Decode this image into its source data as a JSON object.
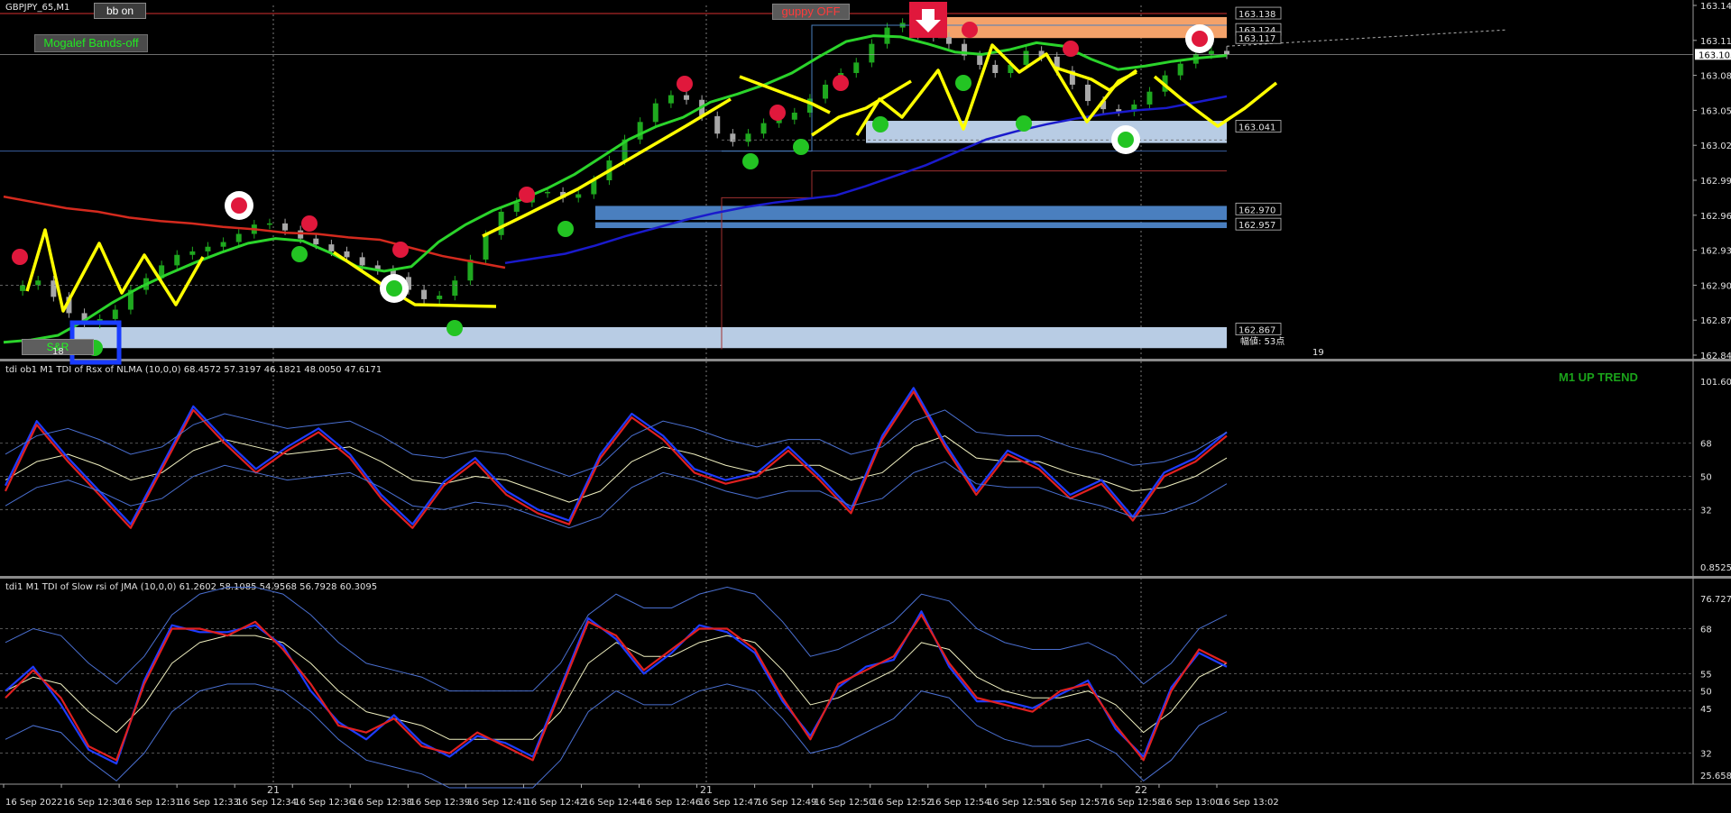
{
  "symbol_label": "GBPJPY_65,M1",
  "buttons": {
    "bb": "bb on",
    "guppy": "guppy OFF",
    "mogalef": "Mogalef Bands-off",
    "sr": "S&R"
  },
  "annotations": {
    "left_bar_count": "18",
    "right_bar_count": "19",
    "range_text": "幅値: 53点",
    "trend_text": "M1 UP TREND"
  },
  "colors": {
    "background": "#000000",
    "ema_red": "#d42a1e",
    "ma_green": "#2bd42b",
    "ma_blue": "#1a1acc",
    "ma_cyan": "#19d7e8",
    "drawn_yellow": "#ffff00",
    "zone_lightblue": "#b8cce4",
    "zone_blue": "#4a7fbf",
    "zone_orange": "#f4a26a",
    "dot_red": "#e0183c",
    "dot_green": "#23c423"
  },
  "chart_data": [
    {
      "type": "candlestick",
      "panel": "main",
      "symbol": "GBPJPY_65",
      "timeframe": "M1",
      "ylim": [
        162.845,
        163.145
      ],
      "y_ticks": [
        163.145,
        163.115,
        163.085,
        163.055,
        163.025,
        162.995,
        162.965,
        162.935,
        162.905,
        162.875,
        162.845
      ],
      "y_tick_labels": [
        "163.145",
        "163.115",
        "163.085",
        "163.055",
        "163.025",
        "162.995",
        "162.965",
        "162.935",
        "162.905",
        "162.875",
        "162.845"
      ],
      "current_price": 163.103,
      "current_price_label": "163.103",
      "price_labels": [
        {
          "value": 163.138,
          "label": "163.138"
        },
        {
          "value": 163.124,
          "label": "163.124"
        },
        {
          "value": 163.117,
          "label": "163.117"
        },
        {
          "value": 163.041,
          "label": "163.041"
        },
        {
          "value": 162.97,
          "label": "162.970"
        },
        {
          "value": 162.957,
          "label": "162.957"
        },
        {
          "value": 162.867,
          "label": "162.867"
        }
      ],
      "zones": [
        {
          "from": 163.117,
          "to": 163.135,
          "color": "orange"
        },
        {
          "from": 163.027,
          "to": 163.046,
          "color": "lightblue"
        },
        {
          "from": 162.961,
          "to": 162.973,
          "color": "blue"
        },
        {
          "from": 162.954,
          "to": 162.959,
          "color": "blue"
        },
        {
          "from": 162.851,
          "to": 162.869,
          "color": "lightblue"
        }
      ],
      "close_series": [
        162.9,
        162.905,
        162.909,
        162.895,
        162.881,
        162.872,
        162.876,
        162.884,
        162.901,
        162.911,
        162.922,
        162.931,
        162.934,
        162.938,
        162.942,
        162.949,
        162.957,
        162.958,
        162.952,
        162.945,
        162.94,
        162.934,
        162.929,
        162.922,
        162.918,
        162.912,
        162.901,
        162.893,
        162.896,
        162.909,
        162.927,
        162.948,
        162.968,
        162.976,
        162.984,
        162.985,
        162.98,
        162.983,
        162.995,
        163.012,
        163.03,
        163.045,
        163.061,
        163.068,
        163.064,
        163.05,
        163.035,
        163.028,
        163.035,
        163.044,
        163.047,
        163.053,
        163.065,
        163.077,
        163.087,
        163.096,
        163.112,
        163.126,
        163.13,
        163.12,
        163.118,
        163.112,
        163.102,
        163.094,
        163.087,
        163.094,
        163.106,
        163.101,
        163.089,
        163.077,
        163.063,
        163.056,
        163.054,
        163.06,
        163.071,
        163.085,
        163.095,
        163.103,
        163.106,
        163.103
      ],
      "ema_red": [
        162.981,
        162.976,
        162.971,
        162.968,
        162.963,
        162.96,
        162.958,
        162.955,
        162.953,
        162.95,
        162.949,
        162.946,
        162.944,
        162.937,
        162.93,
        162.925,
        162.92
      ],
      "ma_green": [
        162.856,
        162.858,
        162.862,
        162.875,
        162.89,
        162.903,
        162.914,
        162.924,
        162.933,
        162.941,
        162.945,
        162.943,
        162.933,
        162.921,
        162.917,
        162.921,
        162.942,
        162.957,
        162.969,
        162.978,
        162.988,
        163.0,
        163.015,
        163.03,
        163.041,
        163.049,
        163.062,
        163.069,
        163.077,
        163.087,
        163.101,
        163.114,
        163.119,
        163.118,
        163.112,
        163.105,
        163.103,
        163.107,
        163.113,
        163.11,
        163.099,
        163.09,
        163.093,
        163.097,
        163.1,
        163.102
      ],
      "ma_blue": [
        162.924,
        162.928,
        162.932,
        162.939,
        162.947,
        162.954,
        162.961,
        162.967,
        162.972,
        162.976,
        162.979,
        162.982,
        162.99,
        162.999,
        163.008,
        163.019,
        163.03,
        163.037,
        163.043,
        163.048,
        163.052,
        163.055,
        163.057,
        163.062,
        163.067
      ],
      "signals_red": [
        [
          0.0,
          162.925
        ],
        [
          0.06,
          162.975
        ],
        [
          0.07,
          162.952
        ],
        [
          0.11,
          162.937
        ],
        [
          0.18,
          163.082
        ],
        [
          0.23,
          163.063
        ],
        [
          0.26,
          163.082
        ],
        [
          0.31,
          163.133
        ],
        [
          0.34,
          163.111
        ]
      ],
      "signals_green": [
        [
          0.09,
          162.945
        ],
        [
          0.12,
          162.923
        ],
        [
          0.13,
          162.955
        ],
        [
          0.18,
          163.022
        ],
        [
          0.2,
          163.031
        ],
        [
          0.3,
          163.057
        ],
        [
          0.32,
          163.093
        ],
        [
          0.33,
          163.058
        ]
      ],
      "x_axis_labels": [
        "16 Sep 2022",
        "16 Sep 12:30",
        "16 Sep 12:31",
        "16 Sep 12:33",
        "16 Sep 12:34",
        "16 Sep 12:36",
        "16 Sep 12:38",
        "16 Sep 12:39",
        "16 Sep 12:41",
        "16 Sep 12:42",
        "16 Sep 12:44",
        "16 Sep 12:46",
        "16 Sep 12:47",
        "16 Sep 12:49",
        "16 Sep 12:50",
        "16 Sep 12:52",
        "16 Sep 12:54",
        "16 Sep 12:55",
        "16 Sep 12:57",
        "16 Sep 12:58",
        "16 Sep 13:00",
        "16 Sep 13:02"
      ],
      "separator_labels": [
        "21",
        "21",
        "22"
      ]
    },
    {
      "type": "line",
      "panel": "indicator1",
      "title": "tdi ob1 M1 TDI of Rsx of NLMA (10,0,0) 68.4572 57.3197 46.1821 48.0050 47.6171",
      "ylim": [
        0.8525,
        101.6078
      ],
      "y_tick_labels": [
        "101.6078",
        "68",
        "50",
        "32",
        "0.8525"
      ],
      "y_levels": [
        68,
        50,
        32
      ],
      "series": [
        {
          "color": "red",
          "values": [
            42,
            78,
            58,
            40,
            22,
            54,
            86,
            68,
            52,
            64,
            74,
            60,
            38,
            22,
            45,
            58,
            40,
            30,
            24,
            60,
            82,
            70,
            52,
            46,
            50,
            64,
            48,
            30,
            70,
            96,
            66,
            40,
            62,
            54,
            38,
            46,
            26,
            50,
            58,
            72
          ]
        },
        {
          "color": "blue",
          "values": [
            45,
            80,
            60,
            42,
            24,
            56,
            88,
            70,
            54,
            66,
            76,
            62,
            40,
            24,
            47,
            60,
            42,
            32,
            26,
            62,
            84,
            72,
            54,
            48,
            52,
            66,
            50,
            32,
            72,
            98,
            68,
            42,
            64,
            56,
            40,
            48,
            28,
            52,
            60,
            74
          ]
        },
        {
          "color": "white",
          "values": [
            48,
            58,
            62,
            56,
            48,
            52,
            64,
            70,
            66,
            62,
            64,
            66,
            58,
            48,
            46,
            50,
            48,
            42,
            36,
            42,
            58,
            66,
            62,
            56,
            52,
            56,
            56,
            48,
            52,
            66,
            72,
            60,
            58,
            58,
            52,
            48,
            42,
            44,
            50,
            60
          ]
        }
      ],
      "trend_label": "M1 UP TREND"
    },
    {
      "type": "line",
      "panel": "indicator2",
      "title": "tdi1 M1 TDI of Slow rsi of JMA (10,0,0) 61.2602 58.1085 54.9568 56.7928 60.3095",
      "ylim": [
        25.6583,
        76.7276
      ],
      "y_tick_labels": [
        "76.7276",
        "68",
        "55",
        "50",
        "45",
        "32",
        "25.6583"
      ],
      "y_levels": [
        68,
        55,
        50,
        45,
        32
      ],
      "series": [
        {
          "color": "red",
          "values": [
            48,
            56,
            48,
            34,
            30,
            52,
            68,
            68,
            66,
            70,
            62,
            52,
            40,
            38,
            42,
            34,
            32,
            38,
            34,
            30,
            50,
            70,
            66,
            56,
            62,
            68,
            68,
            62,
            48,
            36,
            52,
            56,
            60,
            72,
            58,
            48,
            46,
            44,
            50,
            52,
            40,
            30,
            50,
            62,
            58
          ]
        },
        {
          "color": "blue",
          "values": [
            50,
            57,
            46,
            33,
            29,
            53,
            69,
            67,
            67,
            69,
            63,
            50,
            41,
            36,
            43,
            35,
            31,
            37,
            35,
            31,
            51,
            71,
            65,
            55,
            61,
            69,
            67,
            61,
            47,
            37,
            51,
            57,
            59,
            73,
            57,
            47,
            47,
            45,
            49,
            53,
            39,
            31,
            51,
            61,
            57
          ]
        },
        {
          "color": "white",
          "values": [
            50,
            54,
            52,
            44,
            38,
            46,
            58,
            64,
            66,
            66,
            64,
            58,
            50,
            44,
            42,
            40,
            36,
            36,
            36,
            36,
            44,
            58,
            64,
            60,
            60,
            64,
            66,
            64,
            56,
            46,
            48,
            52,
            56,
            64,
            62,
            54,
            50,
            48,
            48,
            50,
            46,
            38,
            44,
            54,
            58
          ]
        }
      ]
    }
  ]
}
